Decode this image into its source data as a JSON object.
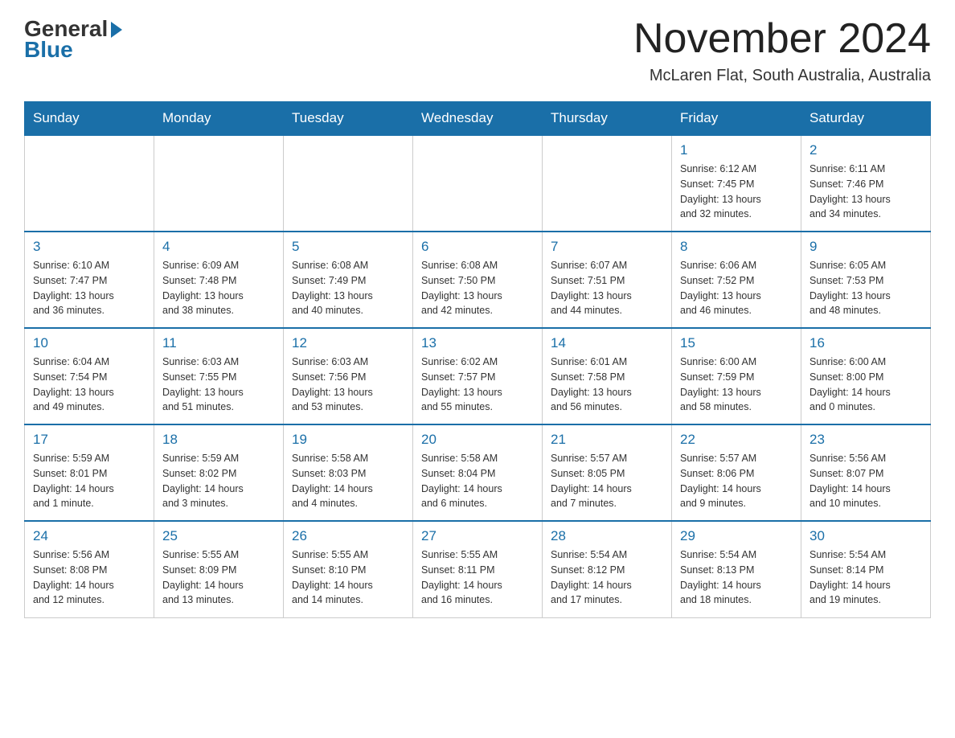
{
  "header": {
    "logo_general": "General",
    "logo_blue": "Blue",
    "month_title": "November 2024",
    "location": "McLaren Flat, South Australia, Australia"
  },
  "weekdays": [
    "Sunday",
    "Monday",
    "Tuesday",
    "Wednesday",
    "Thursday",
    "Friday",
    "Saturday"
  ],
  "weeks": [
    [
      {
        "day": "",
        "info": ""
      },
      {
        "day": "",
        "info": ""
      },
      {
        "day": "",
        "info": ""
      },
      {
        "day": "",
        "info": ""
      },
      {
        "day": "",
        "info": ""
      },
      {
        "day": "1",
        "info": "Sunrise: 6:12 AM\nSunset: 7:45 PM\nDaylight: 13 hours\nand 32 minutes."
      },
      {
        "day": "2",
        "info": "Sunrise: 6:11 AM\nSunset: 7:46 PM\nDaylight: 13 hours\nand 34 minutes."
      }
    ],
    [
      {
        "day": "3",
        "info": "Sunrise: 6:10 AM\nSunset: 7:47 PM\nDaylight: 13 hours\nand 36 minutes."
      },
      {
        "day": "4",
        "info": "Sunrise: 6:09 AM\nSunset: 7:48 PM\nDaylight: 13 hours\nand 38 minutes."
      },
      {
        "day": "5",
        "info": "Sunrise: 6:08 AM\nSunset: 7:49 PM\nDaylight: 13 hours\nand 40 minutes."
      },
      {
        "day": "6",
        "info": "Sunrise: 6:08 AM\nSunset: 7:50 PM\nDaylight: 13 hours\nand 42 minutes."
      },
      {
        "day": "7",
        "info": "Sunrise: 6:07 AM\nSunset: 7:51 PM\nDaylight: 13 hours\nand 44 minutes."
      },
      {
        "day": "8",
        "info": "Sunrise: 6:06 AM\nSunset: 7:52 PM\nDaylight: 13 hours\nand 46 minutes."
      },
      {
        "day": "9",
        "info": "Sunrise: 6:05 AM\nSunset: 7:53 PM\nDaylight: 13 hours\nand 48 minutes."
      }
    ],
    [
      {
        "day": "10",
        "info": "Sunrise: 6:04 AM\nSunset: 7:54 PM\nDaylight: 13 hours\nand 49 minutes."
      },
      {
        "day": "11",
        "info": "Sunrise: 6:03 AM\nSunset: 7:55 PM\nDaylight: 13 hours\nand 51 minutes."
      },
      {
        "day": "12",
        "info": "Sunrise: 6:03 AM\nSunset: 7:56 PM\nDaylight: 13 hours\nand 53 minutes."
      },
      {
        "day": "13",
        "info": "Sunrise: 6:02 AM\nSunset: 7:57 PM\nDaylight: 13 hours\nand 55 minutes."
      },
      {
        "day": "14",
        "info": "Sunrise: 6:01 AM\nSunset: 7:58 PM\nDaylight: 13 hours\nand 56 minutes."
      },
      {
        "day": "15",
        "info": "Sunrise: 6:00 AM\nSunset: 7:59 PM\nDaylight: 13 hours\nand 58 minutes."
      },
      {
        "day": "16",
        "info": "Sunrise: 6:00 AM\nSunset: 8:00 PM\nDaylight: 14 hours\nand 0 minutes."
      }
    ],
    [
      {
        "day": "17",
        "info": "Sunrise: 5:59 AM\nSunset: 8:01 PM\nDaylight: 14 hours\nand 1 minute."
      },
      {
        "day": "18",
        "info": "Sunrise: 5:59 AM\nSunset: 8:02 PM\nDaylight: 14 hours\nand 3 minutes."
      },
      {
        "day": "19",
        "info": "Sunrise: 5:58 AM\nSunset: 8:03 PM\nDaylight: 14 hours\nand 4 minutes."
      },
      {
        "day": "20",
        "info": "Sunrise: 5:58 AM\nSunset: 8:04 PM\nDaylight: 14 hours\nand 6 minutes."
      },
      {
        "day": "21",
        "info": "Sunrise: 5:57 AM\nSunset: 8:05 PM\nDaylight: 14 hours\nand 7 minutes."
      },
      {
        "day": "22",
        "info": "Sunrise: 5:57 AM\nSunset: 8:06 PM\nDaylight: 14 hours\nand 9 minutes."
      },
      {
        "day": "23",
        "info": "Sunrise: 5:56 AM\nSunset: 8:07 PM\nDaylight: 14 hours\nand 10 minutes."
      }
    ],
    [
      {
        "day": "24",
        "info": "Sunrise: 5:56 AM\nSunset: 8:08 PM\nDaylight: 14 hours\nand 12 minutes."
      },
      {
        "day": "25",
        "info": "Sunrise: 5:55 AM\nSunset: 8:09 PM\nDaylight: 14 hours\nand 13 minutes."
      },
      {
        "day": "26",
        "info": "Sunrise: 5:55 AM\nSunset: 8:10 PM\nDaylight: 14 hours\nand 14 minutes."
      },
      {
        "day": "27",
        "info": "Sunrise: 5:55 AM\nSunset: 8:11 PM\nDaylight: 14 hours\nand 16 minutes."
      },
      {
        "day": "28",
        "info": "Sunrise: 5:54 AM\nSunset: 8:12 PM\nDaylight: 14 hours\nand 17 minutes."
      },
      {
        "day": "29",
        "info": "Sunrise: 5:54 AM\nSunset: 8:13 PM\nDaylight: 14 hours\nand 18 minutes."
      },
      {
        "day": "30",
        "info": "Sunrise: 5:54 AM\nSunset: 8:14 PM\nDaylight: 14 hours\nand 19 minutes."
      }
    ]
  ]
}
